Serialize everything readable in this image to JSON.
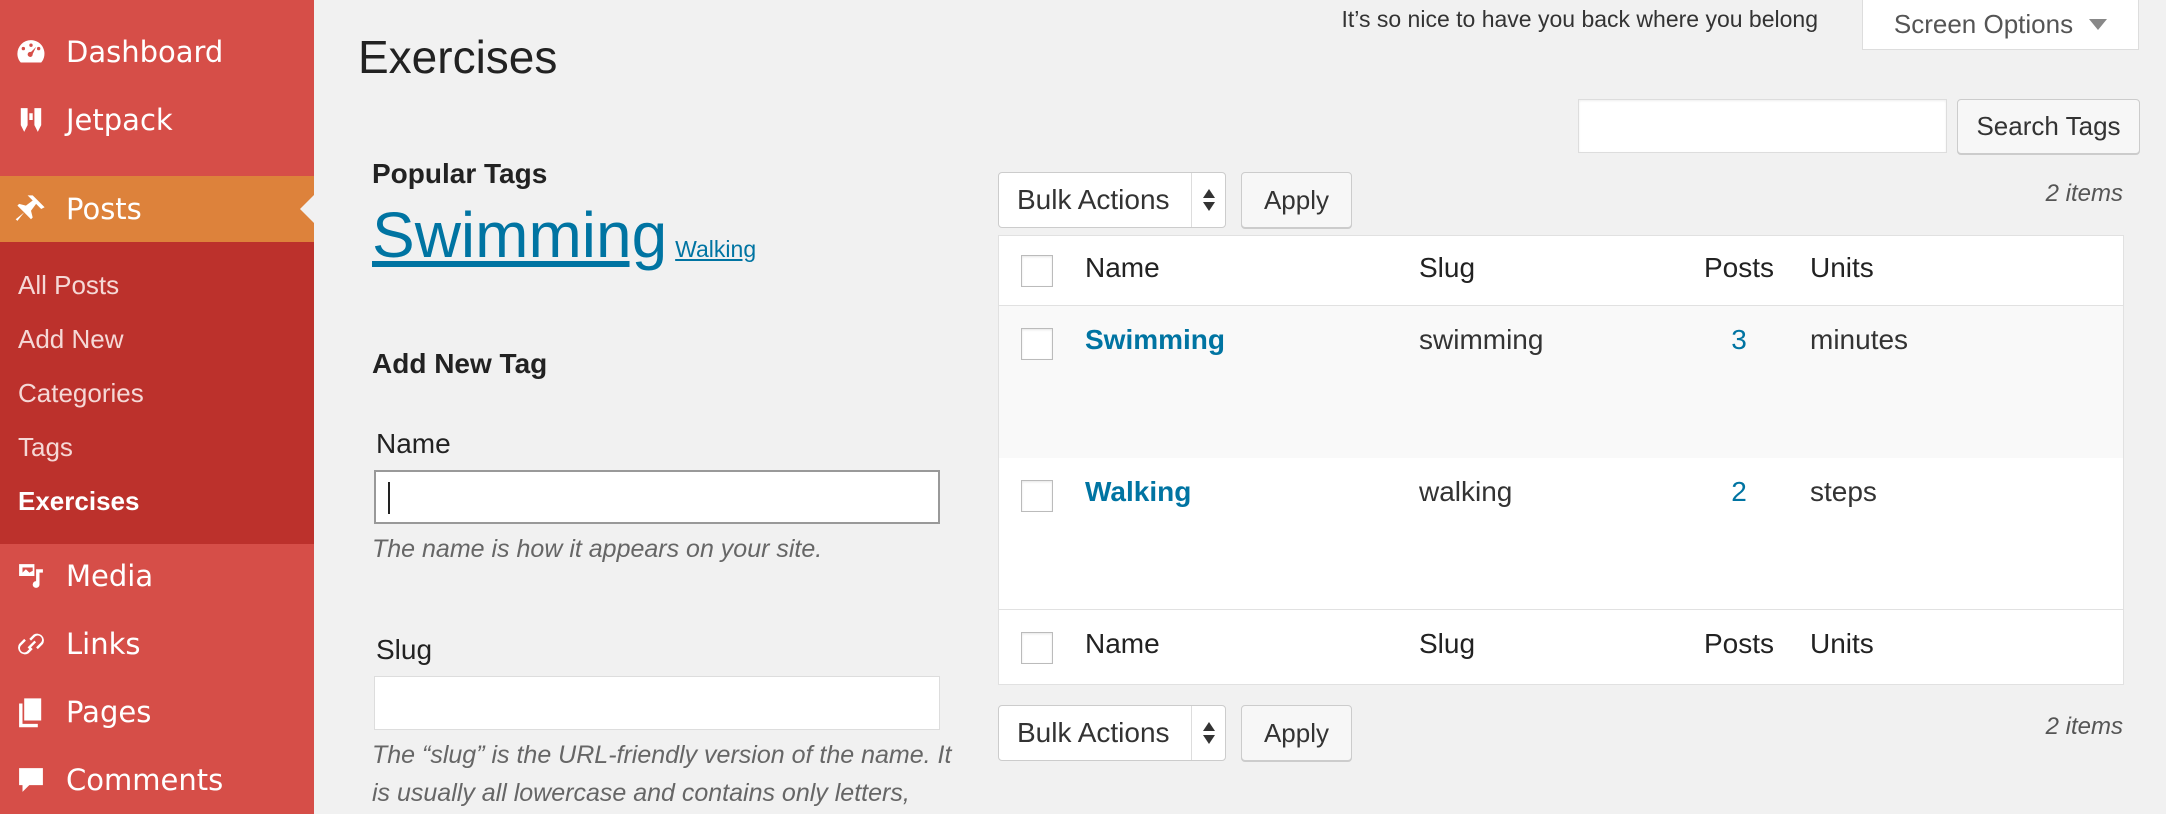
{
  "sidebar": {
    "menu": [
      {
        "label": "Dashboard",
        "icon": "dashboard-icon"
      },
      {
        "label": "Jetpack",
        "icon": "jetpack-icon"
      },
      {
        "label": "Posts",
        "icon": "pin-icon"
      },
      {
        "label": "Media",
        "icon": "media-icon"
      },
      {
        "label": "Links",
        "icon": "link-icon"
      },
      {
        "label": "Pages",
        "icon": "pages-icon"
      },
      {
        "label": "Comments",
        "icon": "comment-icon"
      }
    ],
    "submenu": [
      "All Posts",
      "Add New",
      "Categories",
      "Tags",
      "Exercises"
    ],
    "colors": {
      "sidebar": "#d64e48",
      "active": "#dd823b",
      "submenu": "#bc312c"
    }
  },
  "header": {
    "title": "Exercises",
    "greeting": "It’s so nice to have you back where you belong",
    "screen_options": "Screen Options"
  },
  "search": {
    "value": "",
    "button": "Search Tags"
  },
  "popular": {
    "heading": "Popular Tags",
    "tags": [
      "Swimming",
      "Walking"
    ]
  },
  "add_tag": {
    "heading": "Add New Tag",
    "name_label": "Name",
    "name_value": "",
    "name_desc": "The name is how it appears on your site.",
    "slug_label": "Slug",
    "slug_value": "",
    "slug_desc": "The “slug” is the URL-friendly version of the name. It is usually all lowercase and contains only letters,"
  },
  "table_controls": {
    "bulk_label": "Bulk Actions",
    "apply_label": "Apply",
    "count": "2 items"
  },
  "table": {
    "columns": [
      "Name",
      "Slug",
      "Posts",
      "Units"
    ],
    "rows": [
      {
        "name": "Swimming",
        "slug": "swimming",
        "posts": "3",
        "units": "minutes"
      },
      {
        "name": "Walking",
        "slug": "walking",
        "posts": "2",
        "units": "steps"
      }
    ]
  },
  "accent": "#0074a2"
}
